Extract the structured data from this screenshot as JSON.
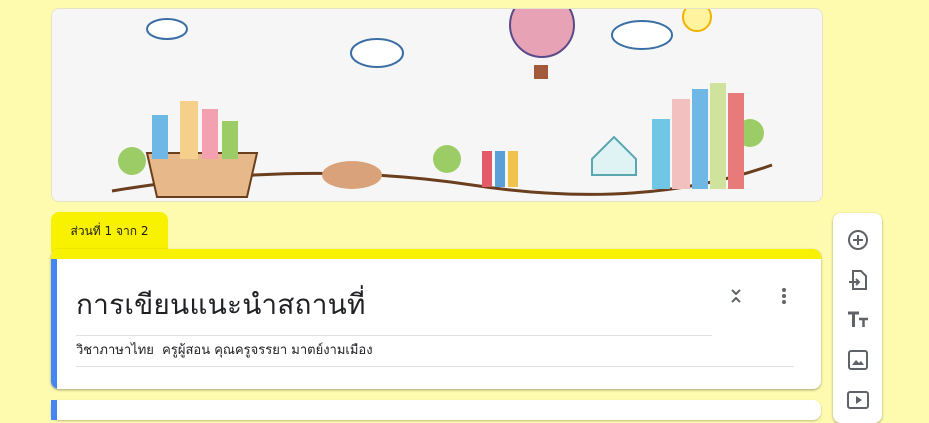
{
  "section": {
    "label": "ส่วนที่ 1 จาก 2"
  },
  "form": {
    "title": "การเขียนแนะนำสถานที่",
    "description": "วิชาภาษาไทย  ครูผู้สอน คุณครูจรรยา มาตย์งามเมือง"
  },
  "theme": {
    "background": "#fffbae",
    "accent": "#f8f200",
    "focus": "#4285f4"
  },
  "toolbar": {
    "items": [
      {
        "icon": "add-question-icon"
      },
      {
        "icon": "import-questions-icon"
      },
      {
        "icon": "add-title-icon"
      },
      {
        "icon": "add-image-icon"
      },
      {
        "icon": "add-video-icon"
      }
    ]
  }
}
